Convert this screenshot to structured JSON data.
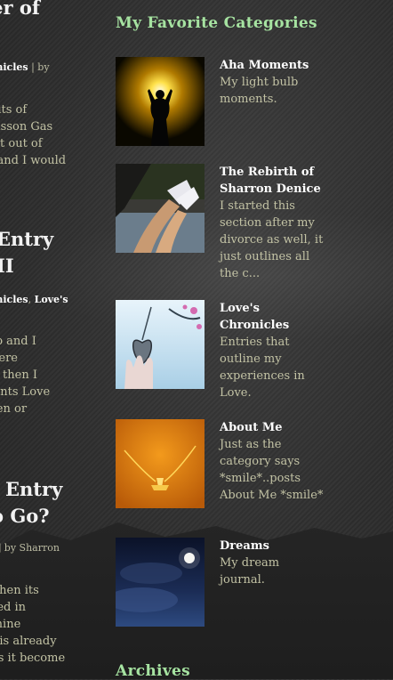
{
  "left_posts": [
    {
      "title_lines": [
        "ower of"
      ],
      "meta": {
        "link": "onicles",
        "sep": " | by"
      },
      "excerpt_lines": [
        "bits of",
        "Sasson  Gas",
        "get out of",
        "d and I would"
      ]
    },
    {
      "title_lines": [
        "Entry",
        "II"
      ],
      "meta": {
        "link": "onicles",
        "sep": ", ",
        "link2": "Love's"
      },
      "excerpt_lines": [
        "ump and I",
        "I were",
        "but then I",
        "resents Love",
        "idden or"
      ]
    },
    {
      "title_lines": [
        "- Entry",
        "o Go?"
      ],
      "meta": {
        "link": "",
        "sep": "] by Sharron"
      },
      "excerpt_lines": [
        "when its",
        "ded in",
        "shine",
        "t is already",
        "es it become"
      ]
    }
  ],
  "sidebar": {
    "categories_title": "My Favorite Categories",
    "categories": [
      {
        "name": "Aha Moments",
        "desc": "My light bulb moments.",
        "icon": "light-bulb-silhouette-photo"
      },
      {
        "name": "The Rebirth of Sharron Denice",
        "desc": "I started this section after my divorce as well, it just outlines all the c...",
        "icon": "feet-relaxing-photo"
      },
      {
        "name": "Love's Chronicles",
        "desc": "Entries that outline my experiences in Love.",
        "icon": "heart-locket-photo"
      },
      {
        "name": "About Me",
        "desc": "Just as the category says *smile*..posts About Me *smile*",
        "icon": "necklace-photo"
      },
      {
        "name": "Dreams",
        "desc": "My dream journal.",
        "icon": "night-sky-photo"
      }
    ],
    "archives_title": "Archives"
  },
  "colors": {
    "accent": "#a6e3a1",
    "text": "#c3c3a5",
    "link": "#ffffff",
    "background": "#2e2e2e"
  }
}
